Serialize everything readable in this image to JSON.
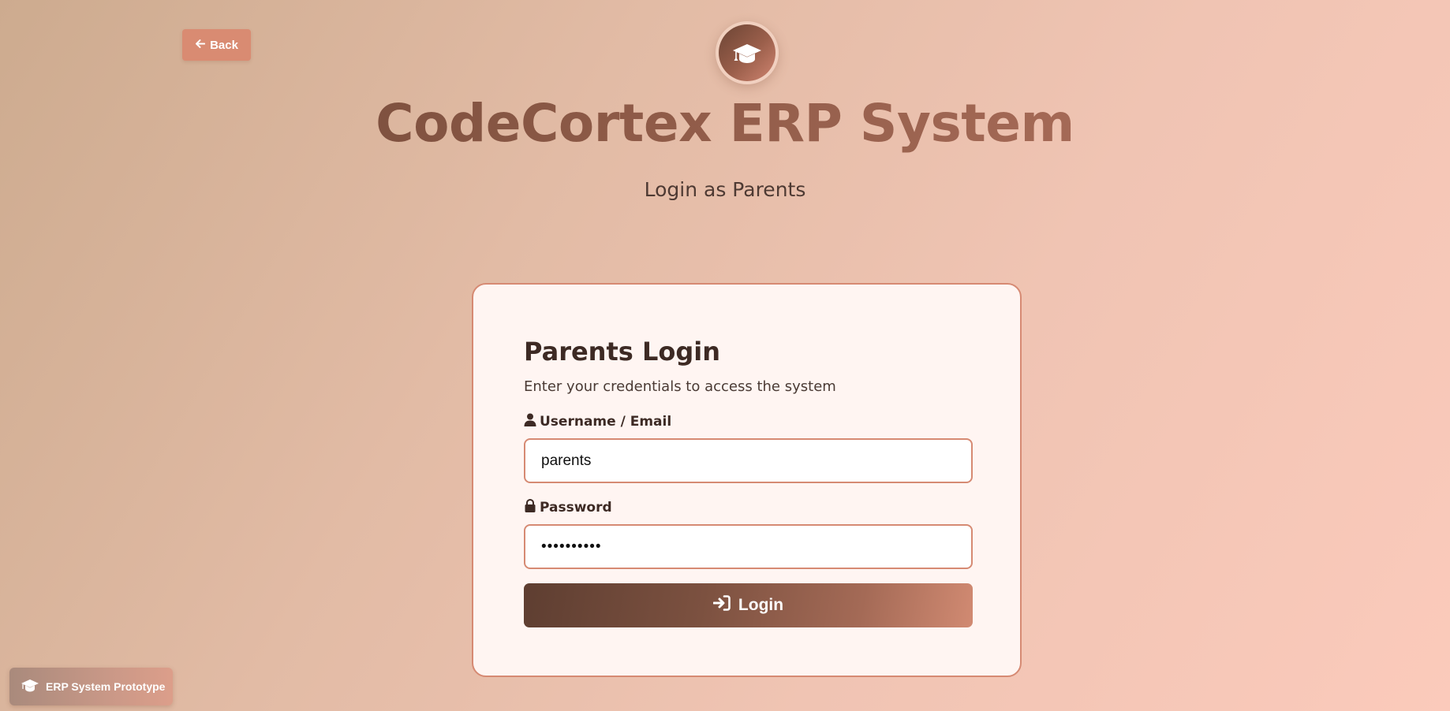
{
  "header": {
    "back_label": "Back",
    "logo_icon": "graduation-cap-icon",
    "title": "CodeCortex ERP System",
    "subtitle": "Login as Parents"
  },
  "login_card": {
    "title": "Parents Login",
    "description": "Enter your credentials to access the system",
    "username_label": "Username / Email",
    "username_value": "parents",
    "password_label": "Password",
    "password_value": "••••••••••",
    "login_label": "Login"
  },
  "footer": {
    "badge_label": "ERP System Prototype"
  },
  "colors": {
    "accent": "#d68a73",
    "button_dark": "#5e3e31",
    "text_dark": "#3d2a24"
  }
}
